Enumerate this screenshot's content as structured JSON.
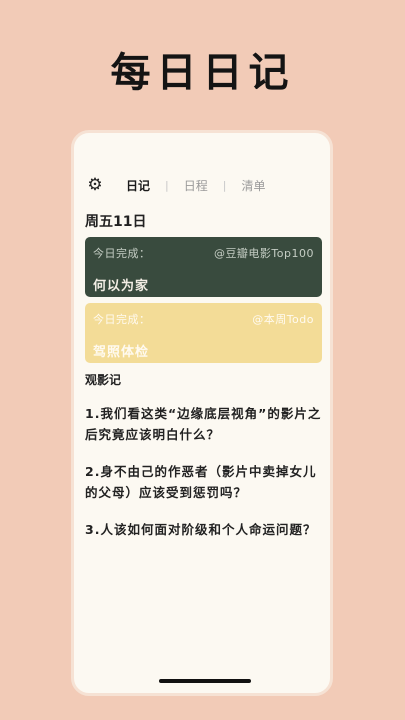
{
  "headline": "每日日记",
  "topbar": {
    "tabs": [
      {
        "label": "日记",
        "active": true
      },
      {
        "label": "日程",
        "active": false
      },
      {
        "label": "清单",
        "active": false
      }
    ],
    "separator": "|"
  },
  "date_label": "周五11日",
  "cards": [
    {
      "label": "今日完成：",
      "source": "@豆瓣电影Top100",
      "title": "何以为家",
      "color": "#394b3e"
    },
    {
      "label": "今日完成：",
      "source": "@本周Todo",
      "title": "驾照体检",
      "color": "#f3dc97"
    }
  ],
  "section_title": "观影记",
  "questions": [
    "1.我们看这类“边缘底层视角”的影片之后究竟应该明白什么？",
    "2.身不由己的作恶者（影片中卖掉女儿的父母）应该受到惩罚吗？",
    "3.人该如何面对阶级和个人命运问题？"
  ]
}
